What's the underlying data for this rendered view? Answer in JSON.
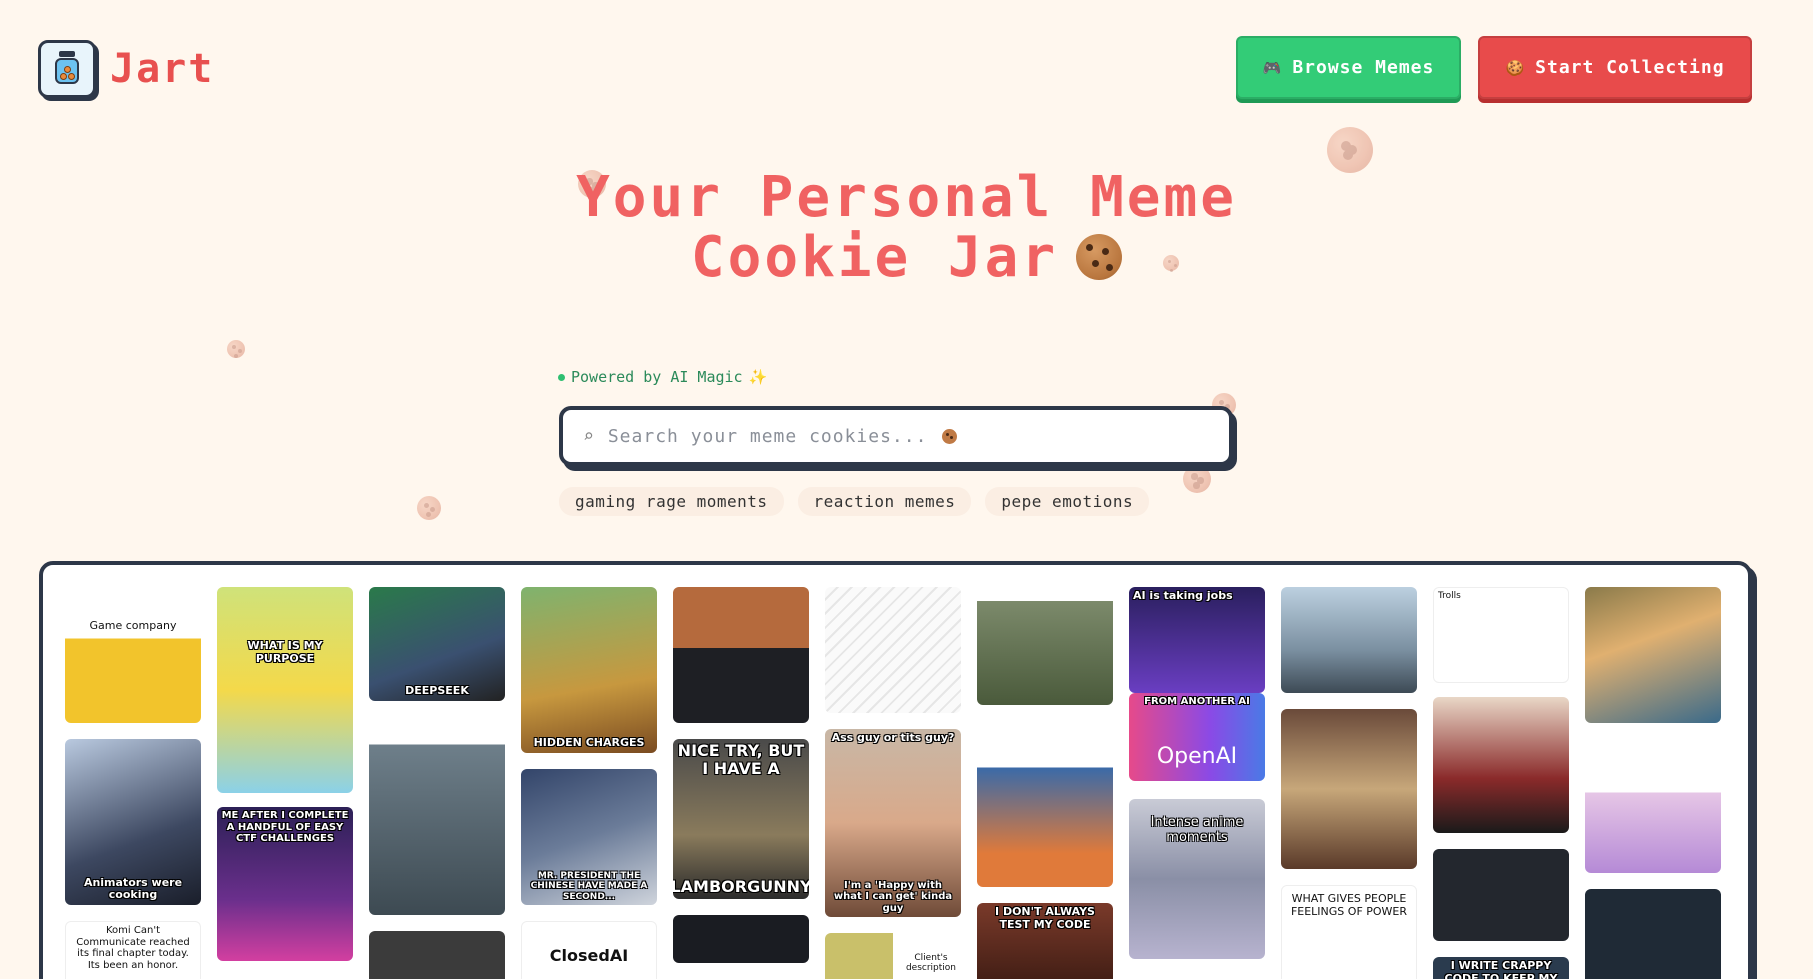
{
  "brand": {
    "name": "Jart",
    "logo_icon": "cookie-jar-icon"
  },
  "header": {
    "browse_label": "Browse Memes",
    "browse_icon": "gamepad-icon",
    "collect_label": "Start Collecting",
    "collect_icon": "cookie-icon"
  },
  "hero": {
    "title_line1": "Your Personal Meme",
    "title_line2": "Cookie Jar",
    "title_icon": "cookie-icon"
  },
  "badge": {
    "label": "Powered by AI Magic",
    "icon": "sparkles-icon"
  },
  "search": {
    "placeholder": "Search your meme cookies...",
    "value": ""
  },
  "suggestions": [
    "gaming rage moments",
    "reaction memes",
    "pepe emotions"
  ],
  "colors": {
    "background": "#fff7ee",
    "brand": "#e8504f",
    "title": "#f06262",
    "browse_button": "#33cc77",
    "collect_button": "#e84b4b",
    "border": "#2d3748"
  },
  "memes": {
    "m1": {
      "text": "Game company"
    },
    "m2": {
      "text": "Animators were cooking"
    },
    "m3": {
      "text": "Komi Can't Communicate reached its final chapter today. Its been an honor."
    },
    "m4": {
      "text": "WHAT IS MY PURPOSE"
    },
    "m5": {
      "text": "ME AFTER I COMPLETE A HANDFUL OF EASY CTF CHALLENGES"
    },
    "m6": {
      "text": "DEEPSEEK"
    },
    "m7": {
      "text": "HIDDEN CHARGES"
    },
    "m8": {
      "text": "MR. PRESIDENT THE CHINESE HAVE MADE A SECOND..."
    },
    "m9": {
      "text": "ClosedAI"
    },
    "m10": {
      "text": "NICE TRY, BUT I HAVE A"
    },
    "m11": {
      "text": "LAMBORGUNNY"
    },
    "m12": {
      "text": "Ass guy or tits guy?"
    },
    "m13": {
      "text": "I'm a 'Happy with what I can get' kinda guy"
    },
    "m14": {
      "text": "Client's description"
    },
    "m15": {
      "text": "I DON'T ALWAYS TEST MY CODE"
    },
    "m16": {
      "text": "AI is taking jobs"
    },
    "m17": {
      "text": "FROM ANOTHER AI"
    },
    "m18": {
      "text": "OpenAI"
    },
    "m19": {
      "text": "Intense anime moments"
    },
    "m20": {
      "text": "WHAT GIVES PEOPLE FEELINGS OF POWER"
    },
    "m21": {
      "text": "Trolls"
    },
    "m22": {
      "text": "I WRITE CRAPPY CODE TO KEEP MY JOB"
    }
  }
}
